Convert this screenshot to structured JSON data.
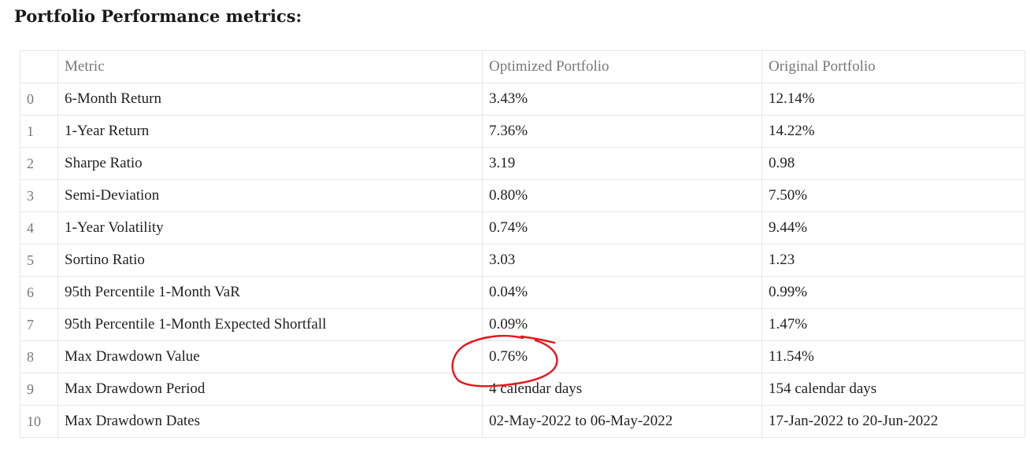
{
  "page": {
    "title": "Portfolio Performance metrics:"
  },
  "table": {
    "headers": [
      "",
      "Metric",
      "Optimized Portfolio",
      "Original Portfolio"
    ],
    "rows": [
      {
        "index": "0",
        "metric": "6-Month Return",
        "optimized": "3.43%",
        "original": "12.14%"
      },
      {
        "index": "1",
        "metric": "1-Year Return",
        "optimized": "7.36%",
        "original": "14.22%"
      },
      {
        "index": "2",
        "metric": "Sharpe Ratio",
        "optimized": "3.19",
        "original": "0.98"
      },
      {
        "index": "3",
        "metric": "Semi-Deviation",
        "optimized": "0.80%",
        "original": "7.50%"
      },
      {
        "index": "4",
        "metric": "1-Year Volatility",
        "optimized": "0.74%",
        "original": "9.44%"
      },
      {
        "index": "5",
        "metric": "Sortino Ratio",
        "optimized": "3.03",
        "original": "1.23"
      },
      {
        "index": "6",
        "metric": "95th Percentile 1-Month VaR",
        "optimized": "0.04%",
        "original": "0.99%"
      },
      {
        "index": "7",
        "metric": "95th Percentile 1-Month Expected Shortfall",
        "optimized": "0.09%",
        "original": "1.47%"
      },
      {
        "index": "8",
        "metric": "Max Drawdown Value",
        "optimized": "0.76%",
        "original": "11.54%"
      },
      {
        "index": "9",
        "metric": "Max Drawdown Period",
        "optimized": "4 calendar days",
        "original": "154 calendar days"
      },
      {
        "index": "10",
        "metric": "Max Drawdown Dates",
        "optimized": "02-May-2022 to 06-May-2022",
        "original": "17-Jan-2022 to 20-Jun-2022"
      }
    ]
  },
  "annotation": {
    "color": "#e8141b",
    "shape": "hand-drawn-circle"
  }
}
